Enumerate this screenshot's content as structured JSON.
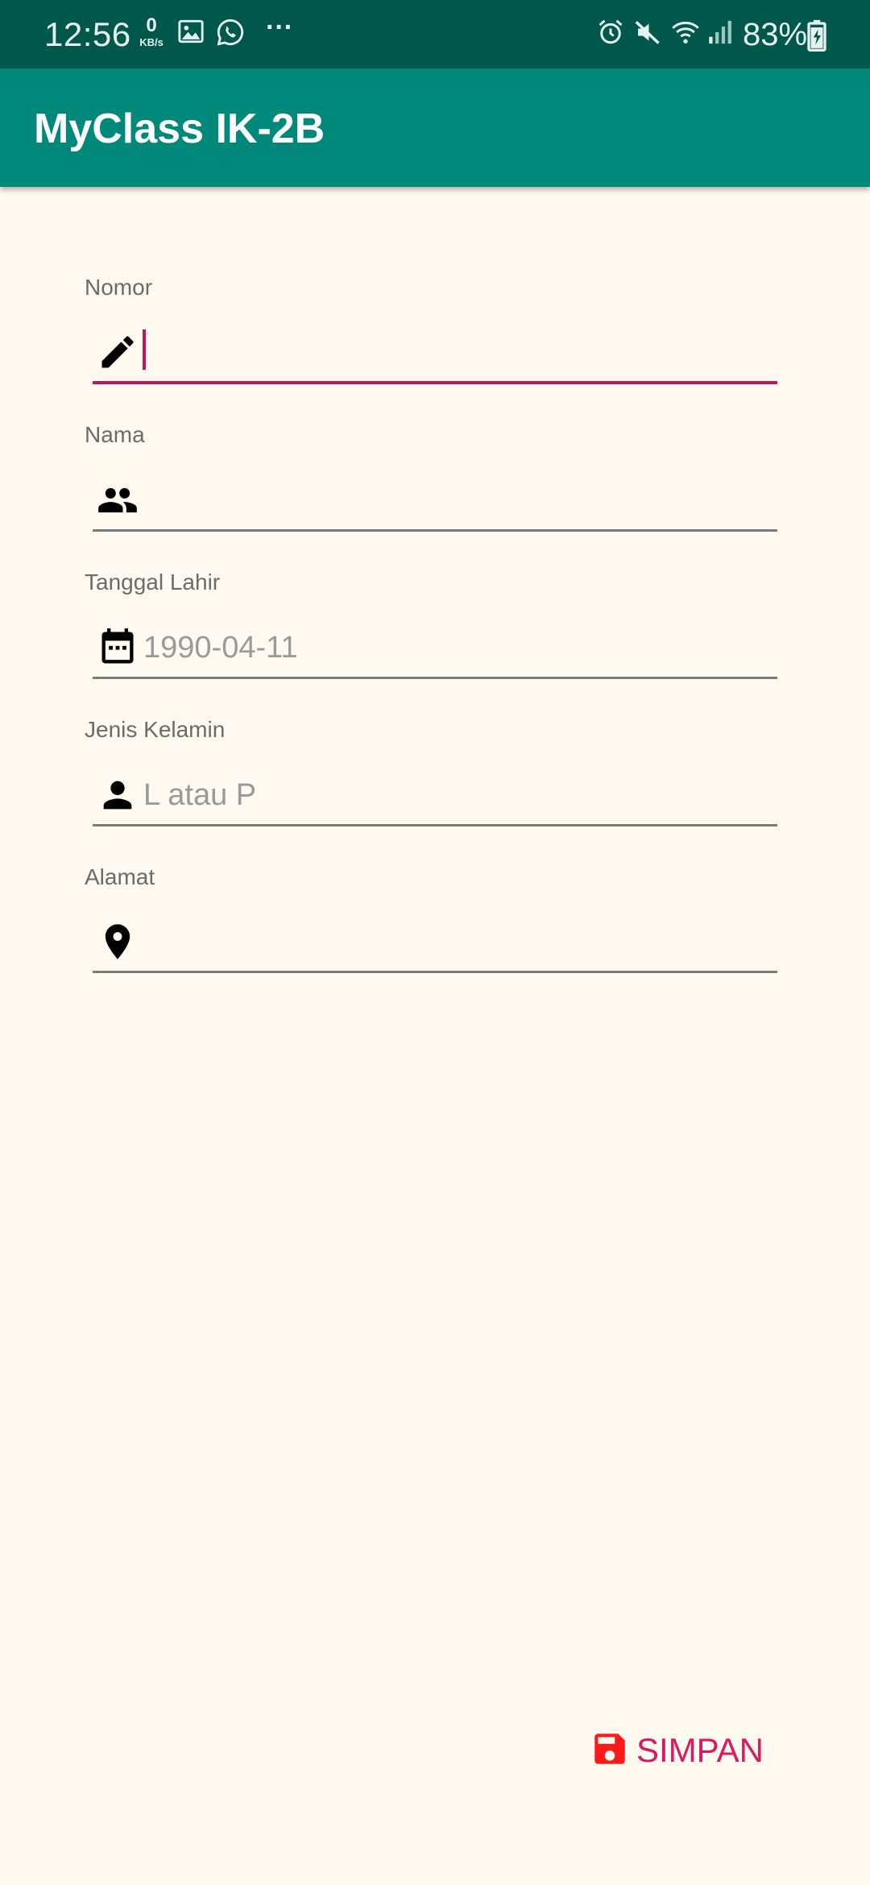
{
  "status_bar": {
    "time": "12:56",
    "network_speed": "0",
    "network_unit": "KB/s",
    "overflow": "···",
    "battery_percent": "83%",
    "icons": [
      "gallery-icon",
      "whatsapp-icon",
      "alarm-icon",
      "mute-icon",
      "wifi-icon",
      "signal-icon",
      "battery-charging-icon"
    ]
  },
  "app_bar": {
    "title": "MyClass IK-2B"
  },
  "form": {
    "fields": [
      {
        "label": "Nomor",
        "value": "",
        "placeholder": "",
        "icon": "pencil-icon"
      },
      {
        "label": "Nama",
        "value": "",
        "placeholder": "",
        "icon": "people-icon"
      },
      {
        "label": "Tanggal Lahir",
        "value": "",
        "placeholder": "1990-04-11",
        "icon": "calendar-icon"
      },
      {
        "label": "Jenis Kelamin",
        "value": "",
        "placeholder": "L atau P",
        "icon": "person-icon"
      },
      {
        "label": "Alamat",
        "value": "",
        "placeholder": "",
        "icon": "location-pin-icon"
      }
    ]
  },
  "actions": {
    "save_label": "SIMPAN",
    "save_icon": "save-icon"
  },
  "colors": {
    "status_bar": "#00574B",
    "app_bar": "#00897B",
    "background": "#FFF9EF",
    "accent": "#C2185B",
    "save_icon": "#FF1A1A",
    "save_text": "#D81B60"
  }
}
